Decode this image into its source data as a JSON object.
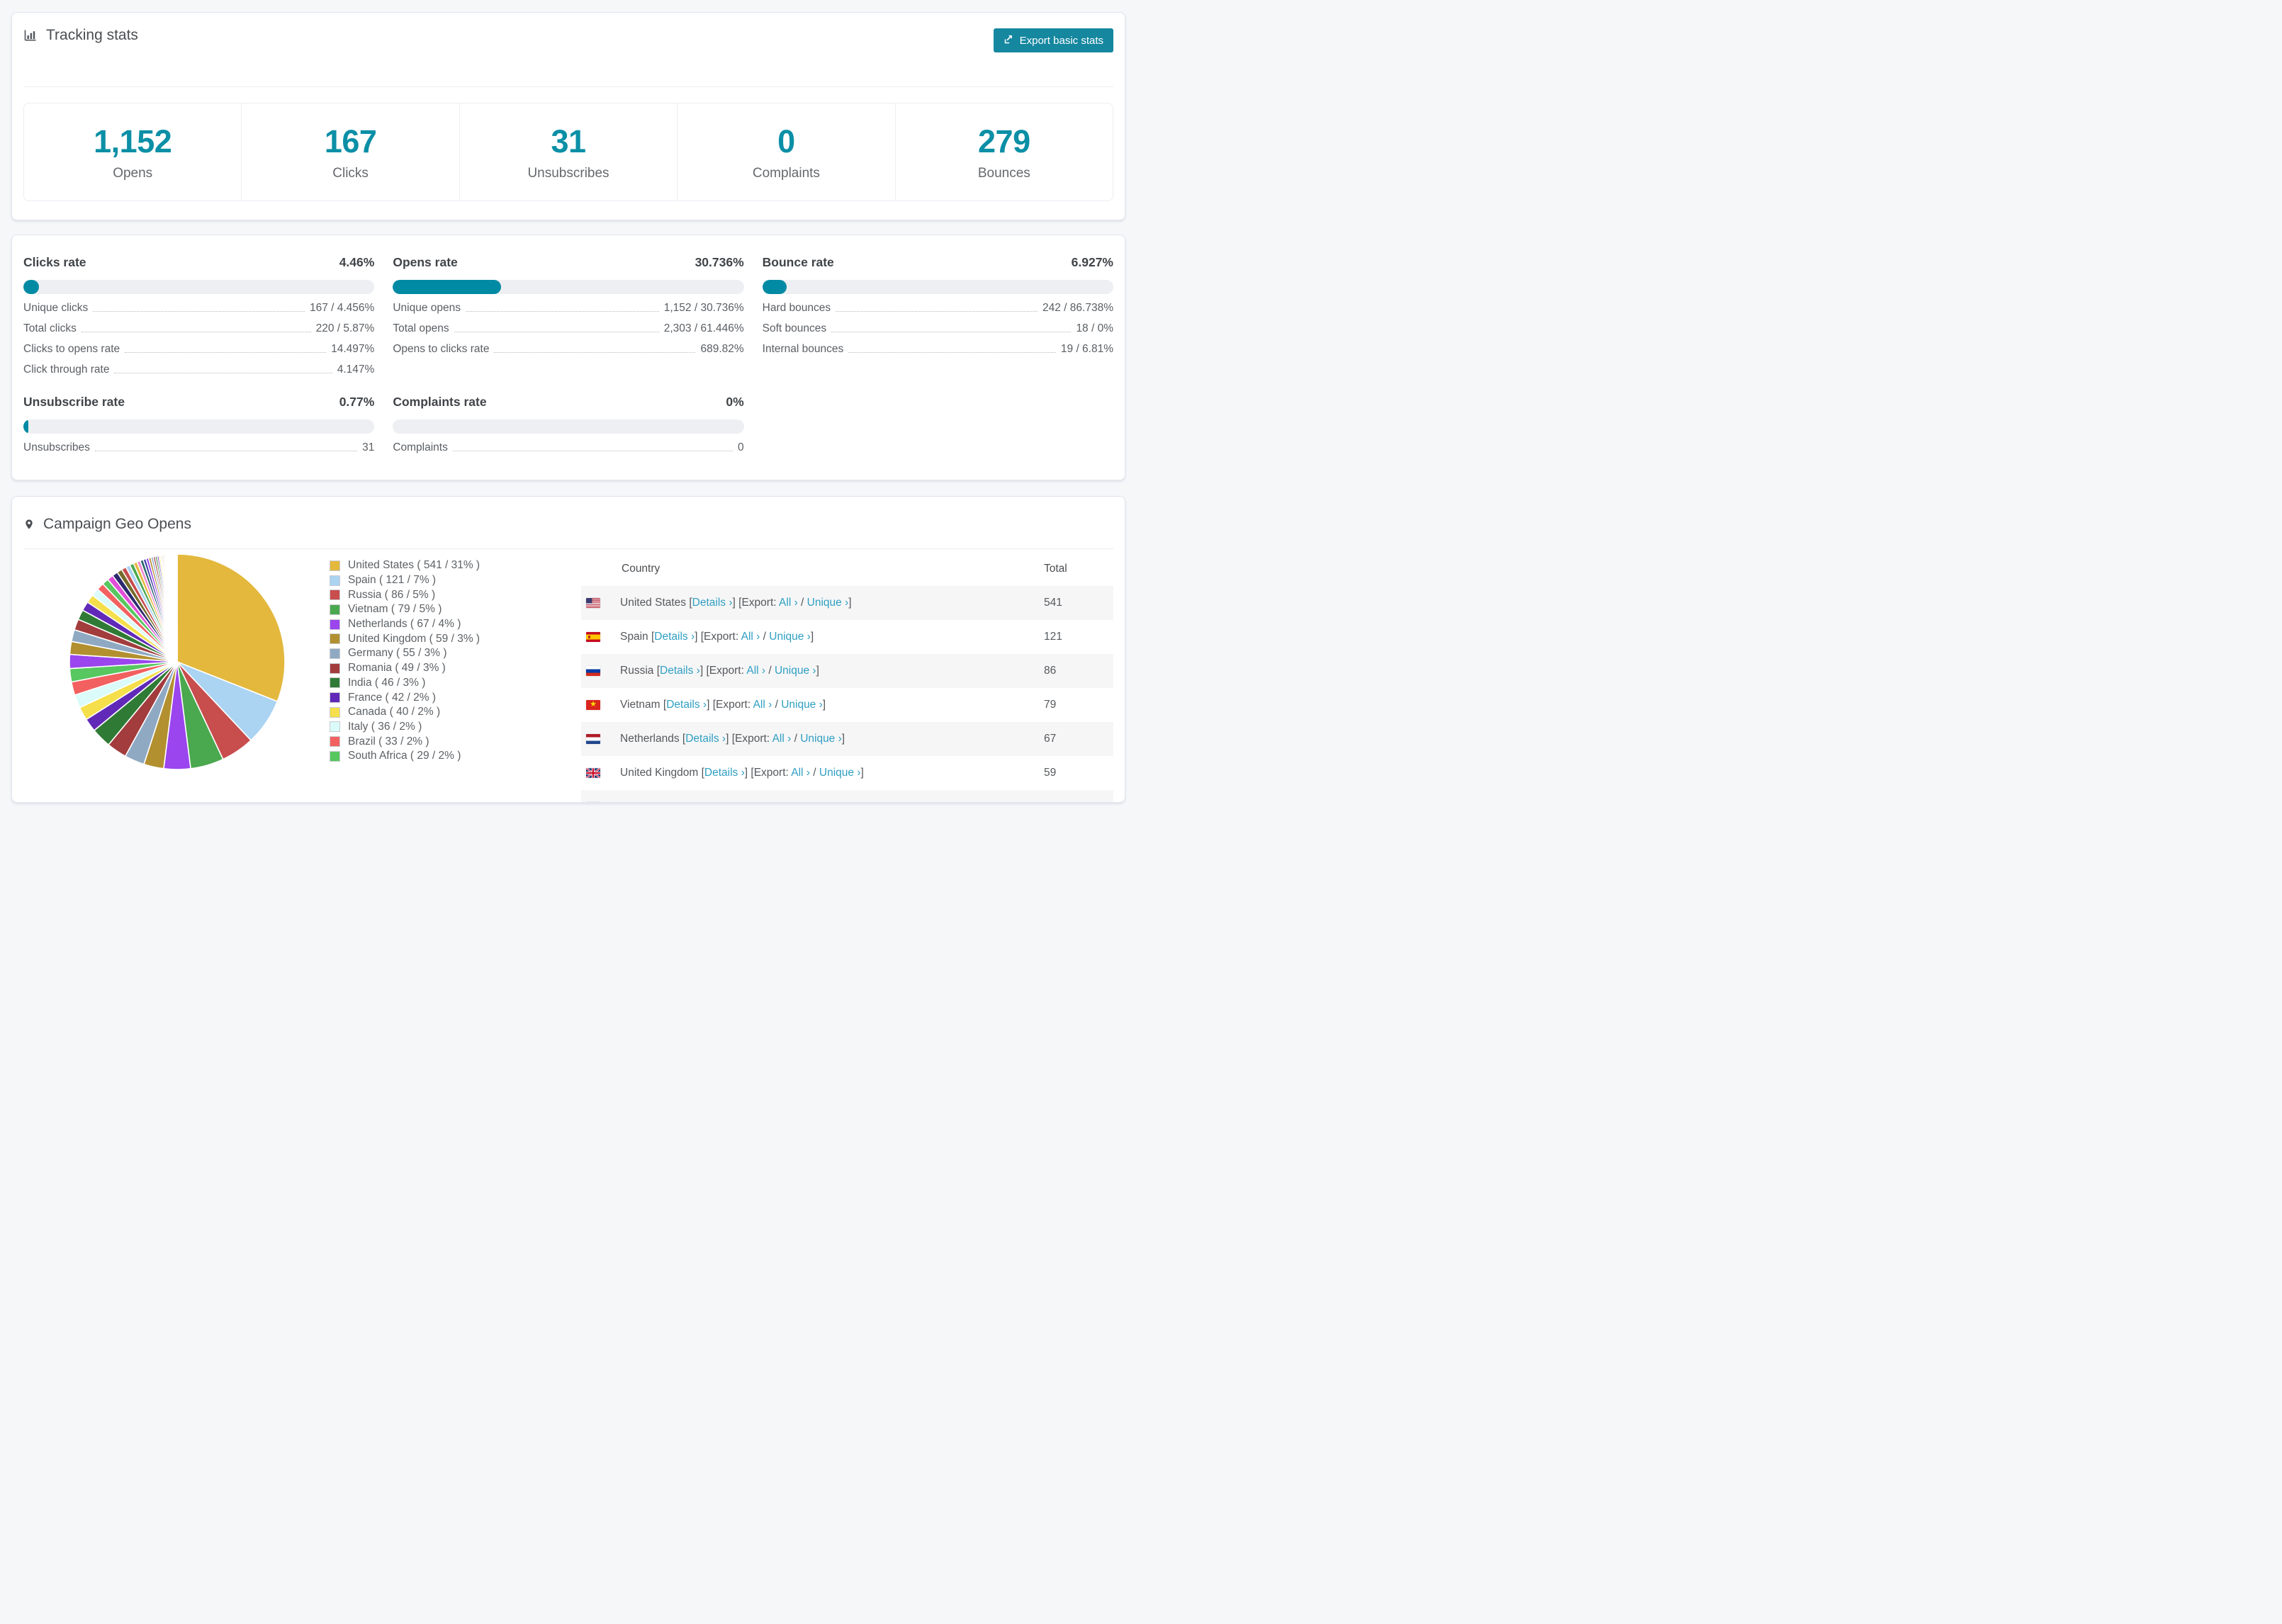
{
  "header": {
    "icon": "bar-chart-icon",
    "title": "Tracking stats",
    "export_button_label": "Export basic stats"
  },
  "summary_stats": [
    {
      "value": "1,152",
      "label": "Opens"
    },
    {
      "value": "167",
      "label": "Clicks"
    },
    {
      "value": "31",
      "label": "Unsubscribes"
    },
    {
      "value": "0",
      "label": "Complaints"
    },
    {
      "value": "279",
      "label": "Bounces"
    }
  ],
  "rate_sections": [
    {
      "id": "clicks-rate",
      "title": "Clicks rate",
      "value": "4.46%",
      "percent": 4.46,
      "rows": [
        {
          "label": "Unique clicks",
          "value": "167 / 4.456%"
        },
        {
          "label": "Total clicks",
          "value": "220 / 5.87%"
        },
        {
          "label": "Clicks to opens rate",
          "value": "14.497%"
        },
        {
          "label": "Click through rate",
          "value": "4.147%"
        }
      ]
    },
    {
      "id": "opens-rate",
      "title": "Opens rate",
      "value": "30.736%",
      "percent": 30.736,
      "rows": [
        {
          "label": "Unique opens",
          "value": "1,152 / 30.736%"
        },
        {
          "label": "Total opens",
          "value": "2,303 / 61.446%"
        },
        {
          "label": "Opens to clicks rate",
          "value": "689.82%"
        }
      ]
    },
    {
      "id": "bounce-rate",
      "title": "Bounce rate",
      "value": "6.927%",
      "percent": 6.927,
      "rows": [
        {
          "label": "Hard bounces",
          "value": "242 / 86.738%"
        },
        {
          "label": "Soft bounces",
          "value": "18 / 0%"
        },
        {
          "label": "Internal bounces",
          "value": "19 / 6.81%"
        }
      ]
    },
    {
      "id": "unsubscribe-rate",
      "title": "Unsubscribe rate",
      "value": "0.77%",
      "percent": 0.77,
      "rows": [
        {
          "label": "Unsubscribes",
          "value": "31"
        }
      ]
    },
    {
      "id": "complaints-rate",
      "title": "Complaints rate",
      "value": "0%",
      "percent": 0,
      "rows": [
        {
          "label": "Complaints",
          "value": "0"
        }
      ]
    }
  ],
  "geo": {
    "icon": "location-pin-icon",
    "title": "Campaign Geo Opens",
    "table": {
      "columns": [
        "Country",
        "Total"
      ],
      "link_parts": {
        "bracket_open": "[",
        "details": "Details ›",
        "bracket_close": "]",
        "export_open": "[Export:",
        "all": "All ›",
        "slash": "/",
        "unique": "Unique ›"
      },
      "rows": [
        {
          "country": "United States",
          "flag": "us",
          "total": "541"
        },
        {
          "country": "Spain",
          "flag": "es",
          "total": "121"
        },
        {
          "country": "Russia",
          "flag": "ru",
          "total": "86"
        },
        {
          "country": "Vietnam",
          "flag": "vn",
          "total": "79"
        },
        {
          "country": "Netherlands",
          "flag": "nl",
          "total": "67"
        },
        {
          "country": "United Kingdom",
          "flag": "gb",
          "total": "59"
        }
      ],
      "partial_row": {
        "flag": "de-partial",
        "country": "",
        "total": ""
      }
    }
  },
  "chart_data": {
    "type": "pie",
    "title": "Campaign Geo Opens",
    "legend_position": "right",
    "start_angle_deg": 0,
    "direction": "clockwise",
    "legend_format": "{name} ( {value} / {percent}% )",
    "series": [
      {
        "name": "United States",
        "value": 541,
        "percent": 31,
        "color": "#e3b83d"
      },
      {
        "name": "Spain",
        "value": 121,
        "percent": 7,
        "color": "#abd3f2"
      },
      {
        "name": "Russia",
        "value": 86,
        "percent": 5,
        "color": "#c84d4d"
      },
      {
        "name": "Vietnam",
        "value": 79,
        "percent": 5,
        "color": "#4aa84f"
      },
      {
        "name": "Netherlands",
        "value": 67,
        "percent": 4,
        "color": "#9a45ee"
      },
      {
        "name": "United Kingdom",
        "value": 59,
        "percent": 3,
        "color": "#b2902f"
      },
      {
        "name": "Germany",
        "value": 55,
        "percent": 3,
        "color": "#8fa9c3"
      },
      {
        "name": "Romania",
        "value": 49,
        "percent": 3,
        "color": "#a23c3d"
      },
      {
        "name": "India",
        "value": 46,
        "percent": 3,
        "color": "#2f7b35"
      },
      {
        "name": "France",
        "value": 42,
        "percent": 2,
        "color": "#6129b8"
      },
      {
        "name": "Canada",
        "value": 40,
        "percent": 2,
        "color": "#f5df4a"
      },
      {
        "name": "Italy",
        "value": 36,
        "percent": 2,
        "color": "#dafbfa"
      },
      {
        "name": "Brazil",
        "value": 33,
        "percent": 2,
        "color": "#f26060"
      },
      {
        "name": "South Africa",
        "value": 29,
        "percent": 2,
        "color": "#57c75f"
      }
    ],
    "others": {
      "percent": 26,
      "note": "long tail of many small unlabeled country slices",
      "palette": [
        "#9a45ee",
        "#b2902f",
        "#8fa9c3",
        "#a23c3d",
        "#2f7b35",
        "#6129b8",
        "#f5df4a",
        "#dafbfa",
        "#f26060",
        "#57c75f",
        "#e14fd8",
        "#2c2a6e",
        "#756a28",
        "#c84d4d",
        "#abd3f2",
        "#4aa84f",
        "#e3b83d",
        "#f08bd1",
        "#27626b",
        "#4343a8"
      ]
    }
  },
  "colors": {
    "accent_teal_bar": "#008aa4",
    "stat_number_teal": "#0b8fa6",
    "link_teal": "#2f9fc2",
    "button_teal": "#15879f",
    "bar_track_gray": "#edeff2",
    "row_stripe_gray": "#f6f6f7"
  }
}
